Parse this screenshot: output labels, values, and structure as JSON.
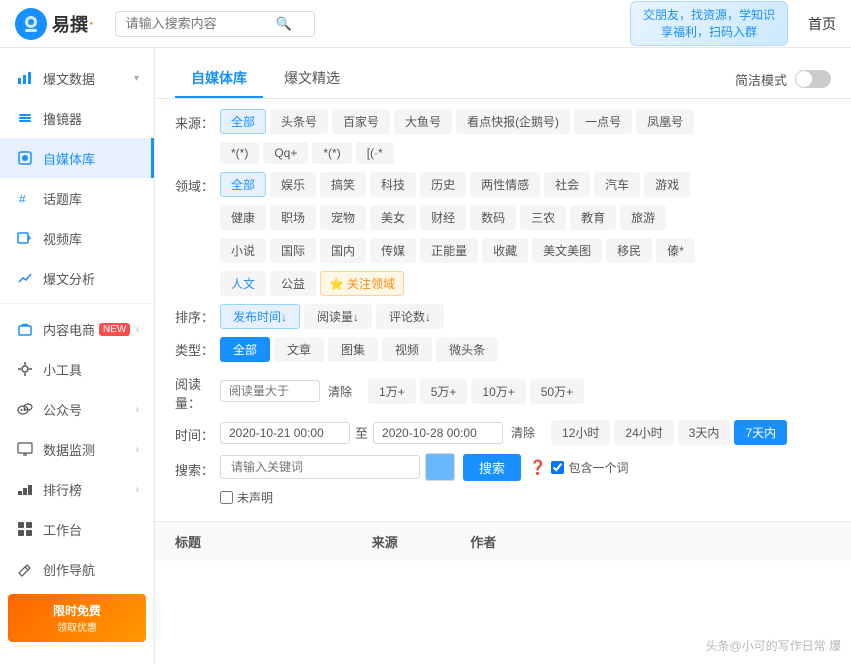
{
  "header": {
    "logo_text": "易撰",
    "logo_dot": "·",
    "search_placeholder": "请输入搜索内容",
    "banner_line1": "交朋友，找资源，学知识",
    "banner_line2": "享福利，扫码入群",
    "nav_home": "首页"
  },
  "sidebar": {
    "items": [
      {
        "id": "baowendata",
        "label": "爆文数据",
        "icon": "chart-icon",
        "arrow": true
      },
      {
        "id": "pingjijing",
        "label": "撸镜器",
        "icon": "tool-icon",
        "arrow": false
      },
      {
        "id": "ziweiti",
        "label": "自媒体库",
        "icon": "media-icon",
        "arrow": false,
        "active": true
      },
      {
        "id": "huatiku",
        "label": "话题库",
        "icon": "topic-icon",
        "arrow": false
      },
      {
        "id": "shipinku",
        "label": "视频库",
        "icon": "video-icon",
        "arrow": false
      },
      {
        "id": "baowen",
        "label": "爆文分析",
        "icon": "analysis-icon",
        "arrow": false
      },
      {
        "id": "ecommerce",
        "label": "内容电商",
        "icon": "shop-icon",
        "arrow": true,
        "badge": "NEW"
      },
      {
        "id": "tools",
        "label": "小工具",
        "icon": "tools-icon",
        "arrow": false
      },
      {
        "id": "gongzhong",
        "label": "公众号",
        "icon": "wechat-icon",
        "arrow": true
      },
      {
        "id": "monitor",
        "label": "数据监测",
        "icon": "monitor-icon",
        "arrow": true
      },
      {
        "id": "ranking",
        "label": "排行榜",
        "icon": "rank-icon",
        "arrow": true
      },
      {
        "id": "workspace",
        "label": "工作台",
        "icon": "workspace-icon",
        "arrow": false
      },
      {
        "id": "creation",
        "label": "创作导航",
        "icon": "creation-icon",
        "arrow": false
      }
    ],
    "promo": {
      "label": "限时免费",
      "sub": "领取优惠"
    }
  },
  "main": {
    "tabs": [
      {
        "id": "ziwei",
        "label": "自媒体库",
        "active": true
      },
      {
        "id": "baowenjingxuan",
        "label": "爆文精选"
      },
      {
        "id": "jianjiemoshi",
        "label": "简洁模式"
      }
    ],
    "filters": {
      "source_label": "来源：",
      "sources": [
        {
          "label": "全部",
          "active": true
        },
        {
          "label": "头条号"
        },
        {
          "label": "百家号"
        },
        {
          "label": "大鱼号"
        },
        {
          "label": "看点快报(企鹅号)"
        },
        {
          "label": "一点号"
        },
        {
          "label": "凤凰号"
        }
      ],
      "sources_row2": [
        {
          "label": "*(*)"
        },
        {
          "label": "Qq+"
        },
        {
          "label": "*(*)"
        },
        {
          "label": "[(·*"
        }
      ],
      "domain_label": "领域：",
      "domains": [
        {
          "label": "全部",
          "active": true
        },
        {
          "label": "娱乐"
        },
        {
          "label": "搞笑"
        },
        {
          "label": "科技"
        },
        {
          "label": "历史"
        },
        {
          "label": "两性情感"
        },
        {
          "label": "社会"
        },
        {
          "label": "汽车"
        },
        {
          "label": "游戏"
        }
      ],
      "domains_row2": [
        {
          "label": "健康"
        },
        {
          "label": "职场"
        },
        {
          "label": "宠物"
        },
        {
          "label": "美女"
        },
        {
          "label": "财经"
        },
        {
          "label": "数码"
        },
        {
          "label": "三农"
        },
        {
          "label": "教育"
        },
        {
          "label": "旅游"
        }
      ],
      "domains_row3": [
        {
          "label": "小说"
        },
        {
          "label": "国际"
        },
        {
          "label": "国内"
        },
        {
          "label": "传媒"
        },
        {
          "label": "正能量"
        },
        {
          "label": "收藏"
        },
        {
          "label": "美文美图"
        },
        {
          "label": "移民"
        },
        {
          "label": "傣*"
        }
      ],
      "domains_row4": [
        {
          "label": "人文"
        },
        {
          "label": "公益"
        }
      ],
      "attention_label": "关注领域",
      "sort_label": "排序：",
      "sorts": [
        {
          "label": "发布时间↓",
          "active": true
        },
        {
          "label": "阅读量↓"
        },
        {
          "label": "评论数↓"
        }
      ],
      "type_label": "类型：",
      "types": [
        {
          "label": "全部",
          "active": true
        },
        {
          "label": "文章"
        },
        {
          "label": "图集"
        },
        {
          "label": "视频"
        },
        {
          "label": "微头条"
        }
      ],
      "read_label": "阅读量：",
      "read_placeholder": "阅读量大于",
      "read_clear": "清除",
      "reads": [
        {
          "label": "1万+"
        },
        {
          "label": "5万+"
        },
        {
          "label": "10万+"
        },
        {
          "label": "50万+"
        }
      ],
      "time_label": "时间：",
      "time_start": "2020-10-21 00:00",
      "time_end": "2020-10-28 00:00",
      "time_clear": "清除",
      "time_options": [
        {
          "label": "12小时"
        },
        {
          "label": "24小时"
        },
        {
          "label": "3天内"
        },
        {
          "label": "7天内",
          "active": true
        }
      ],
      "search_label": "搜索：",
      "keyword_placeholder": "请输入关键词",
      "search_btn": "搜索",
      "include_word": "包含一个词",
      "undeclared": "未声明"
    },
    "table": {
      "cols": [
        {
          "label": "标题"
        },
        {
          "label": "来源"
        },
        {
          "label": "作者"
        }
      ]
    }
  },
  "watermark": "头条@小可的写作日常 爆"
}
